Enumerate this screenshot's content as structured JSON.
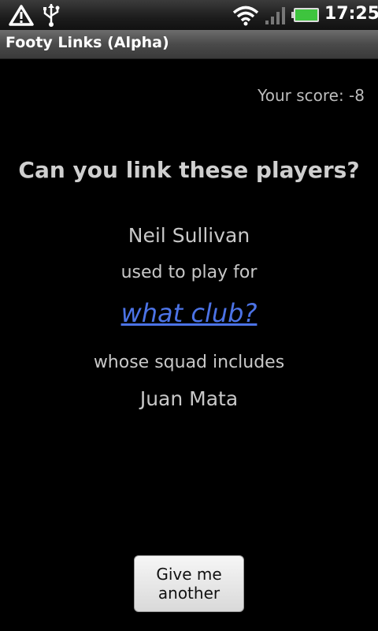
{
  "status_bar": {
    "time": "17:25",
    "icons": [
      "warning-icon",
      "usb-icon",
      "wifi-icon",
      "signal-icon",
      "battery-icon"
    ],
    "battery_color": "#3ec43e"
  },
  "app": {
    "title": "Footy Links (Alpha)"
  },
  "game": {
    "score_label": "Your score: -8",
    "question": "Can you link these players?",
    "player1": "Neil Sullivan",
    "connector1": "used to play for",
    "club_prompt": "what club?",
    "connector2": "whose squad includes",
    "player2": "Juan Mata",
    "link_color": "#4c73e6"
  },
  "actions": {
    "another_button": "Give me another"
  }
}
